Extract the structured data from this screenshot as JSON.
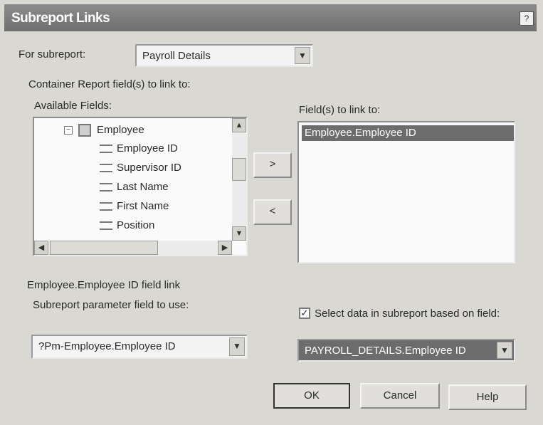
{
  "window": {
    "title": "Subreport Links",
    "help_glyph": "?"
  },
  "for_subreport": {
    "label": "For subreport:",
    "value": "Payroll Details"
  },
  "group_label": "Container Report field(s) to link to:",
  "available_fields": {
    "label": "Available Fields:",
    "tree": [
      {
        "kind": "table",
        "label": "Employee"
      },
      {
        "kind": "field",
        "label": "Employee ID"
      },
      {
        "kind": "field",
        "label": "Supervisor ID"
      },
      {
        "kind": "field",
        "label": "Last Name"
      },
      {
        "kind": "field",
        "label": "First Name"
      },
      {
        "kind": "field",
        "label": "Position"
      }
    ]
  },
  "move_right_label": ">",
  "move_left_label": "<",
  "fields_to_link": {
    "label": "Field(s) to link to:",
    "items": [
      "Employee.Employee ID"
    ]
  },
  "field_link_label": "Employee.Employee ID field link",
  "subreport_parameter": {
    "label": "Subreport parameter field to use:",
    "value": "?Pm-Employee.Employee ID"
  },
  "select_data": {
    "checked": true,
    "label": "Select data in subreport based on field:",
    "value": "PAYROLL_DETAILS.Employee ID"
  },
  "buttons": {
    "ok": "OK",
    "cancel": "Cancel",
    "help": "Help"
  },
  "glyphs": {
    "dropdown": "▼",
    "up": "▲",
    "down": "▼",
    "left": "◀",
    "right": "▶",
    "check": "✓",
    "minus": "−"
  }
}
